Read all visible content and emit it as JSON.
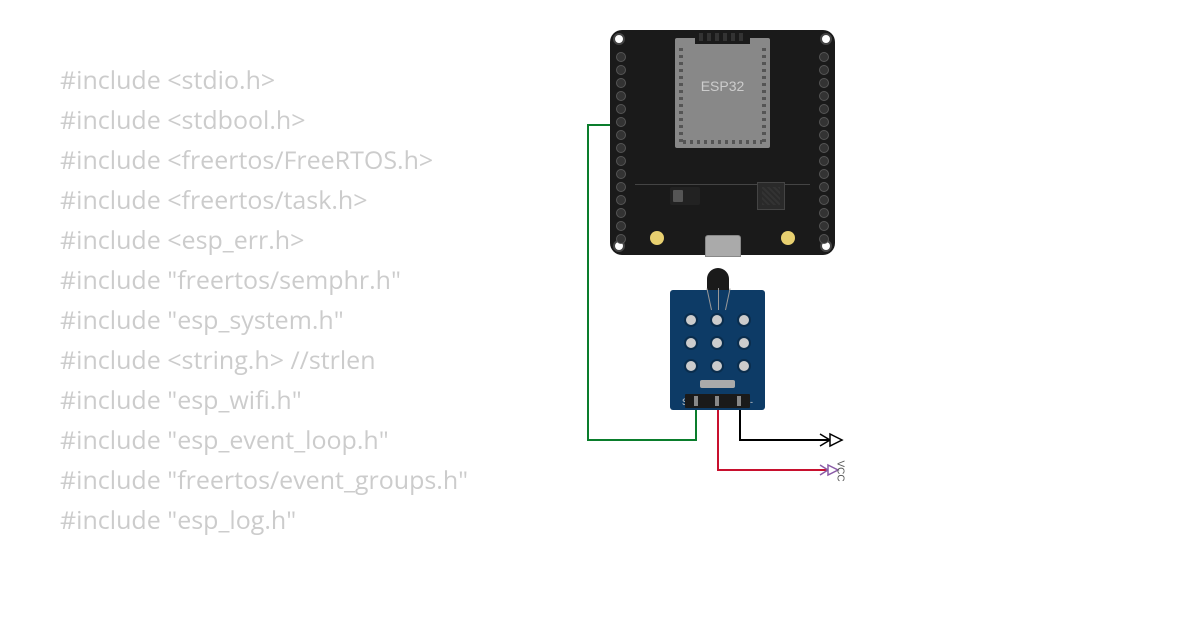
{
  "code": {
    "lines": [
      {
        "text": "#include <stdio.h>",
        "comment": ""
      },
      {
        "text": "#include <stdbool.h>",
        "comment": ""
      },
      {
        "text": "#include <freertos/FreeRTOS.h>",
        "comment": ""
      },
      {
        "text": "#include <freertos/task.h>",
        "comment": ""
      },
      {
        "text": "#include <esp_err.h>",
        "comment": ""
      },
      {
        "text": "#include \"freertos/semphr.h\"",
        "comment": ""
      },
      {
        "text": "#include \"esp_system.h\"",
        "comment": ""
      },
      {
        "text": "#include <string.h>",
        "comment": "    //strlen"
      },
      {
        "text": "#include \"esp_wifi.h\"",
        "comment": ""
      },
      {
        "text": "#include \"esp_event_loop.h\"",
        "comment": ""
      },
      {
        "text": "#include \"freertos/event_groups.h\"",
        "comment": ""
      },
      {
        "text": "#include \"esp_log.h\"",
        "comment": ""
      }
    ]
  },
  "diagram": {
    "board": {
      "name": "ESP32",
      "label": "ESP32",
      "type": "microcontroller",
      "pin_count_per_side": 15
    },
    "sensor": {
      "name": "thermistor-module",
      "pin_labels": {
        "signal": "S",
        "ground": "-"
      },
      "vcc_label": "VCC"
    },
    "wires": [
      {
        "color": "green",
        "from": "esp32-pin-left",
        "to": "sensor-signal",
        "hex": "#0a7d2c"
      },
      {
        "color": "black",
        "from": "sensor-ground",
        "to": "gnd-arrow",
        "hex": "#000000"
      },
      {
        "color": "red",
        "from": "sensor-vcc",
        "to": "vcc-arrow",
        "hex": "#c8102e"
      }
    ]
  }
}
